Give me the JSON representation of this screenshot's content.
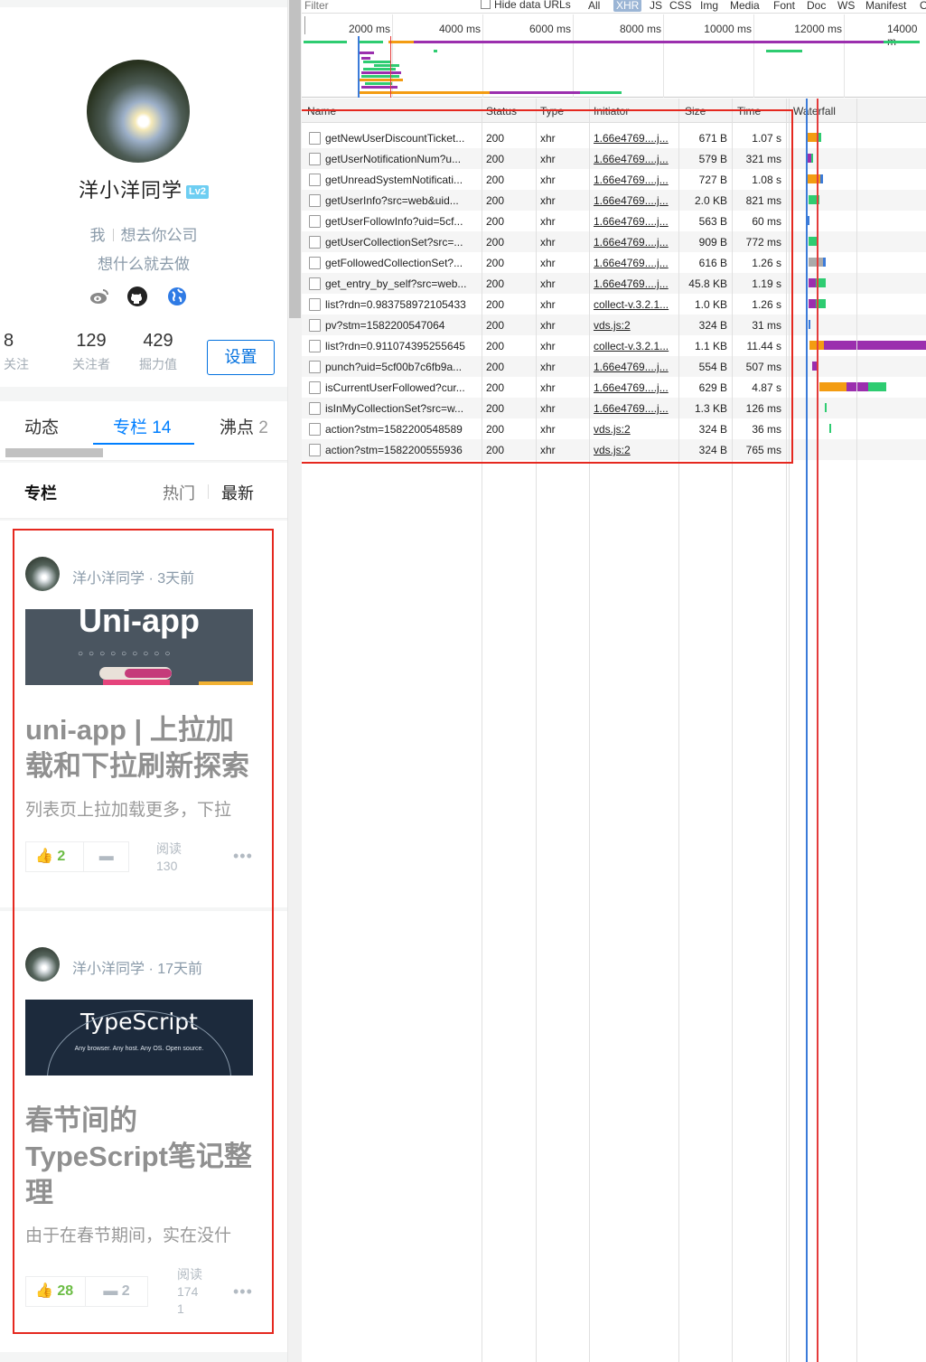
{
  "left": {
    "profile": {
      "username": "洋小洋同学",
      "level_badge": "Lv2",
      "role_me": "我",
      "role_company": "想去你公司",
      "bio": "想什么就去做",
      "social_icons": [
        "weibo-icon",
        "github-icon",
        "website-icon"
      ],
      "stats": [
        {
          "num": "8",
          "label": "关注"
        },
        {
          "num": "129",
          "label": "关注者"
        },
        {
          "num": "429",
          "label": "掘力值"
        }
      ],
      "settings_label": "设置"
    },
    "tabs": {
      "dongtai": "动态",
      "zhuanlan": "专栏",
      "zhuanlan_count": "14",
      "feidian": "沸点",
      "feidian_count": "2"
    },
    "section": {
      "title": "专栏",
      "hot": "热门",
      "newest": "最新"
    },
    "articles": [
      {
        "author": "洋小洋同学",
        "time": "3天前",
        "cover_text": "Uni-app",
        "title": "uni-app | 上拉加载和下拉刷新探索",
        "desc": "列表页上拉加载更多，下拉",
        "likes": "2",
        "comments": "",
        "read_label": "阅读",
        "read_count": "130",
        "read_count_tail": ""
      },
      {
        "author": "洋小洋同学",
        "time": "17天前",
        "cover_text": "TypeScript",
        "cover_subtext": "Any browser. Any host. Any OS. Open source.",
        "title": "春节间的TypeScript笔记整理",
        "desc": "由于在春节期间，实在没什",
        "likes": "28",
        "comments": "2",
        "read_label": "阅读",
        "read_count": "174",
        "read_count_tail": "1"
      }
    ]
  },
  "devtools": {
    "filter_placeholder": "Filter",
    "hide_data_urls": "Hide data URLs",
    "filter_types": [
      "All",
      "XHR",
      "JS",
      "CSS",
      "Img",
      "Media",
      "Font",
      "Doc",
      "WS",
      "Manifest",
      "O"
    ],
    "overview_ticks": [
      "2000 ms",
      "4000 ms",
      "6000 ms",
      "8000 ms",
      "10000 ms",
      "12000 ms",
      "14000 m"
    ],
    "columns": {
      "name": "Name",
      "status": "Status",
      "type": "Type",
      "initiator": "Initiator",
      "size": "Size",
      "time": "Time",
      "waterfall": "Waterfall"
    },
    "requests": [
      {
        "name": "getNewUserDiscountTicket...",
        "status": "200",
        "type": "xhr",
        "initiator": "1.66e4769....j...",
        "size": "671 B",
        "time": "1.07 s"
      },
      {
        "name": "getUserNotificationNum?u...",
        "status": "200",
        "type": "xhr",
        "initiator": "1.66e4769....j...",
        "size": "579 B",
        "time": "321 ms"
      },
      {
        "name": "getUnreadSystemNotificati...",
        "status": "200",
        "type": "xhr",
        "initiator": "1.66e4769....j...",
        "size": "727 B",
        "time": "1.08 s"
      },
      {
        "name": "getUserInfo?src=web&uid...",
        "status": "200",
        "type": "xhr",
        "initiator": "1.66e4769....j...",
        "size": "2.0 KB",
        "time": "821 ms"
      },
      {
        "name": "getUserFollowInfo?uid=5cf...",
        "status": "200",
        "type": "xhr",
        "initiator": "1.66e4769....j...",
        "size": "563 B",
        "time": "60 ms"
      },
      {
        "name": "getUserCollectionSet?src=...",
        "status": "200",
        "type": "xhr",
        "initiator": "1.66e4769....j...",
        "size": "909 B",
        "time": "772 ms"
      },
      {
        "name": "getFollowedCollectionSet?...",
        "status": "200",
        "type": "xhr",
        "initiator": "1.66e4769....j...",
        "size": "616 B",
        "time": "1.26 s"
      },
      {
        "name": "get_entry_by_self?src=web...",
        "status": "200",
        "type": "xhr",
        "initiator": "1.66e4769....j...",
        "size": "45.8 KB",
        "time": "1.19 s"
      },
      {
        "name": "list?rdn=0.983758972105433",
        "status": "200",
        "type": "xhr",
        "initiator": "collect-v.3.2.1...",
        "size": "1.0 KB",
        "time": "1.26 s"
      },
      {
        "name": "pv?stm=1582200547064",
        "status": "200",
        "type": "xhr",
        "initiator": "vds.js:2",
        "size": "324 B",
        "time": "31 ms"
      },
      {
        "name": "list?rdn=0.911074395255645",
        "status": "200",
        "type": "xhr",
        "initiator": "collect-v.3.2.1...",
        "size": "1.1 KB",
        "time": "11.44 s"
      },
      {
        "name": "punch?uid=5cf00b7c6fb9a...",
        "status": "200",
        "type": "xhr",
        "initiator": "1.66e4769....j...",
        "size": "554 B",
        "time": "507 ms"
      },
      {
        "name": "isCurrentUserFollowed?cur...",
        "status": "200",
        "type": "xhr",
        "initiator": "1.66e4769....j...",
        "size": "629 B",
        "time": "4.87 s"
      },
      {
        "name": "isInMyCollectionSet?src=w...",
        "status": "200",
        "type": "xhr",
        "initiator": "1.66e4769....j...",
        "size": "1.3 KB",
        "time": "126 ms"
      },
      {
        "name": "action?stm=1582200548589",
        "status": "200",
        "type": "xhr",
        "initiator": "vds.js:2",
        "size": "324 B",
        "time": "36 ms"
      },
      {
        "name": "action?stm=1582200555936",
        "status": "200",
        "type": "xhr",
        "initiator": "vds.js:2",
        "size": "324 B",
        "time": "765 ms"
      }
    ],
    "colors": {
      "wait": "#f39c12",
      "download": "#2ecc71",
      "purple": "#9b2fae",
      "queue": "#aaaaaa",
      "blue": "#3b7bd9",
      "red": "#e43c3c",
      "highlight": "#e5281f"
    }
  }
}
